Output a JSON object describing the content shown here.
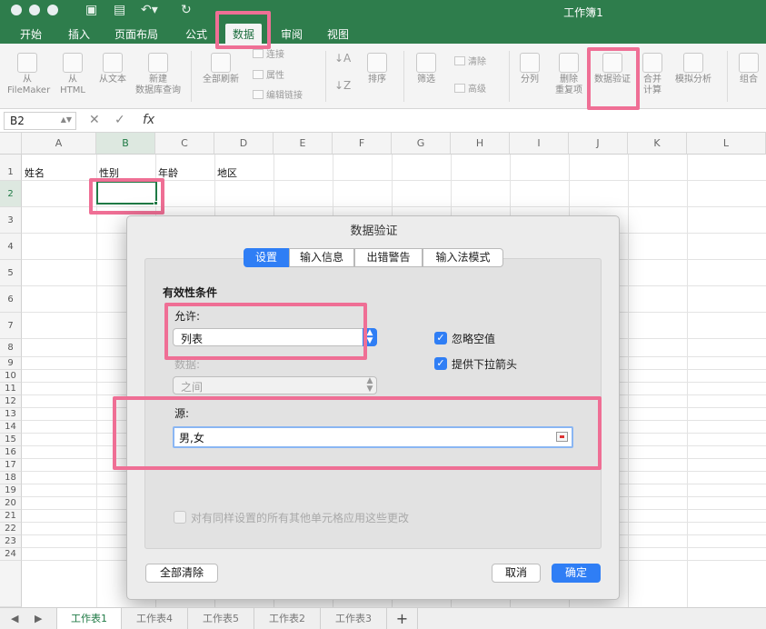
{
  "window": {
    "title": "工作簿1"
  },
  "ribbon_tabs": [
    "开始",
    "插入",
    "页面布局",
    "公式",
    "数据",
    "审阅",
    "视图"
  ],
  "active_tab": "数据",
  "ribbon": {
    "from_filemaker": {
      "line1": "从",
      "line2": "FileMaker"
    },
    "from_html": {
      "line1": "从",
      "line2": "HTML"
    },
    "from_text": "从文本",
    "new_db_query": {
      "line1": "新建",
      "line2": "数据库查询"
    },
    "refresh_all": "全部刷新",
    "connections": "连接",
    "properties": "属性",
    "edit_links": "编辑链接",
    "sort": "排序",
    "filter": "筛选",
    "clear": "清除",
    "advanced": "高级",
    "text_to_columns": "分列",
    "remove_duplicates": {
      "line1": "删除",
      "line2": "重复项"
    },
    "data_validation": "数据验证",
    "consolidate": {
      "line1": "合并",
      "line2": "计算"
    },
    "what_if": "模拟分析",
    "group": "组合"
  },
  "formula_bar": {
    "cell_ref": "B2",
    "fx": "fx",
    "value": ""
  },
  "columns": [
    "A",
    "B",
    "C",
    "D",
    "E",
    "F",
    "G",
    "H",
    "I",
    "J",
    "K",
    "L"
  ],
  "rows": [
    "1",
    "2",
    "3",
    "4",
    "5",
    "6",
    "7",
    "8",
    "9",
    "10",
    "11",
    "12",
    "13",
    "14",
    "15",
    "16",
    "17",
    "18",
    "19",
    "20",
    "21",
    "22",
    "23",
    "24"
  ],
  "cells": {
    "A1": "姓名",
    "B1": "性别",
    "C1": "年龄",
    "D1": "地区"
  },
  "dialog": {
    "title": "数据验证",
    "tabs": [
      "设置",
      "输入信息",
      "出错警告",
      "输入法模式"
    ],
    "active_tab": "设置",
    "section_title": "有效性条件",
    "allow_label": "允许:",
    "allow_value": "列表",
    "data_label": "数据:",
    "data_value": "之间",
    "ignore_blank": {
      "label": "忽略空值",
      "checked": true
    },
    "in_cell_dropdown": {
      "label": "提供下拉箭头",
      "checked": true
    },
    "source_label": "源:",
    "source_value": "男,女",
    "apply_all": {
      "label": "对有同样设置的所有其他单元格应用这些更改",
      "checked": false
    },
    "clear_all": "全部清除",
    "cancel": "取消",
    "ok": "确定"
  },
  "sheet_tabs": [
    "工作表1",
    "工作表4",
    "工作表5",
    "工作表2",
    "工作表3"
  ],
  "active_sheet": "工作表1",
  "add_sheet": "+",
  "colors": {
    "excel_green": "#2e7d4c",
    "highlight_pink": "#ef6f95",
    "mac_blue": "#2f7ef5"
  }
}
